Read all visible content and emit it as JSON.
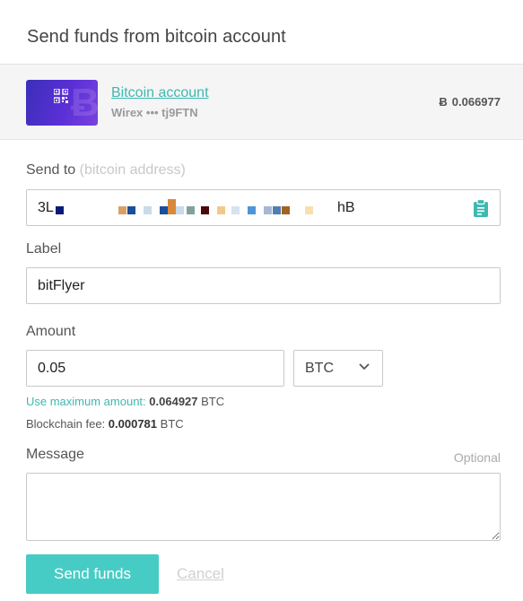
{
  "modal": {
    "title": "Send funds from bitcoin account"
  },
  "account": {
    "name": "Bitcoin account",
    "subtitle": "Wirex ••• tj9FTN",
    "balance_symbol": "Ƀ",
    "balance": "0.066977",
    "card_icon": "qr-code-icon"
  },
  "send_to": {
    "label": "Send to",
    "hint": "(bitcoin address)",
    "address_start": "3L",
    "address_end": "hB",
    "redaction_colors": [
      "#0b1a7a",
      "#d9a066",
      "#1b4e9b",
      "#c9dbe8",
      "#1b4e9b",
      "#d88a3a",
      "#c9dbe8",
      "#7fa39b",
      "#4a0a0a",
      "#f2c98a",
      "#d5e3ef",
      "#4f95d6",
      "#a6b8d6",
      "#4f7fb0",
      "#a0641e",
      "#f7dfb0"
    ],
    "paste_icon": "clipboard-icon"
  },
  "label_field": {
    "label": "Label",
    "value": "bitFlyer"
  },
  "amount": {
    "label": "Amount",
    "value": "0.05",
    "currency": "BTC",
    "max_prefix": "Use maximum amount:",
    "max_value": "0.064927",
    "max_unit": "BTC",
    "fee_prefix": "Blockchain fee:",
    "fee_value": "0.000781",
    "fee_unit": "BTC"
  },
  "message": {
    "label": "Message",
    "optional": "Optional",
    "value": ""
  },
  "actions": {
    "send_label": "Send funds",
    "cancel_label": "Cancel"
  },
  "colors": {
    "accent": "#47ccc5",
    "link": "#3fb8b0",
    "card_start": "#3a2fb8",
    "card_end": "#7a42e0"
  }
}
